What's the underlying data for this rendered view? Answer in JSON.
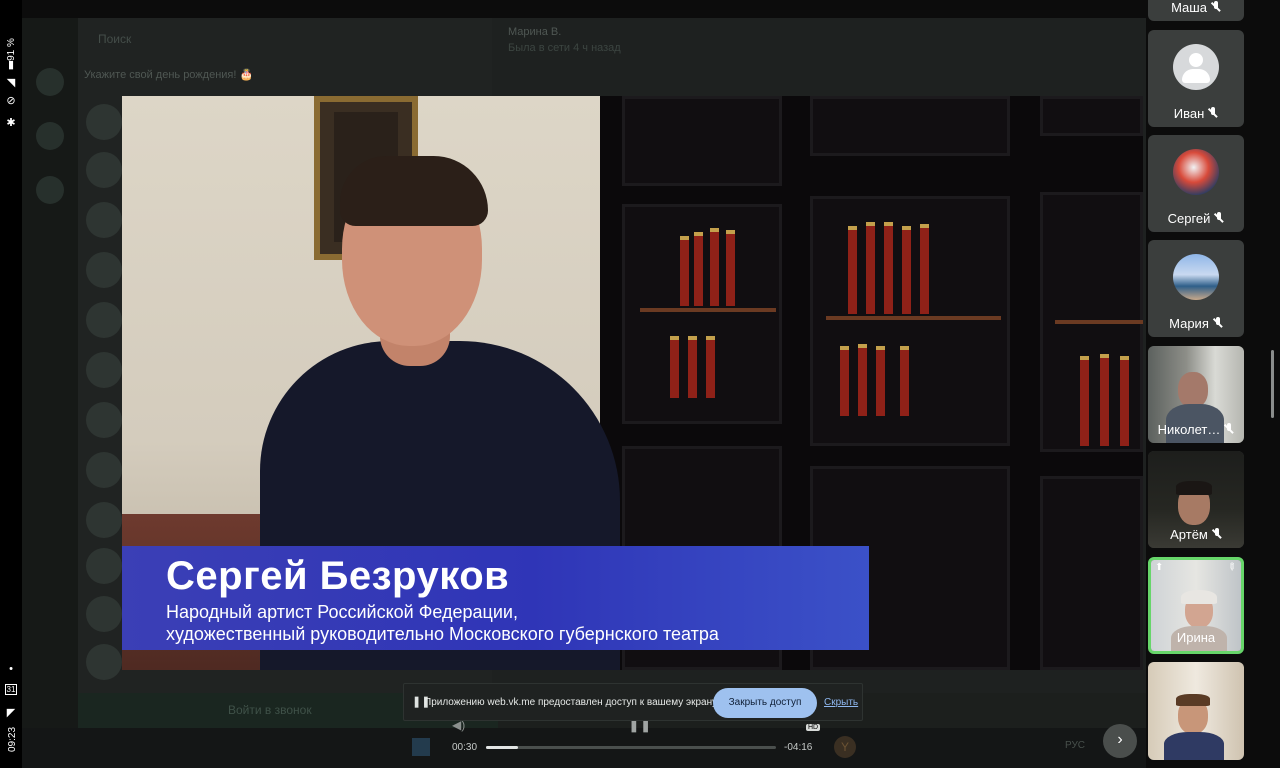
{
  "status_bar": {
    "battery": "91 %",
    "time": "09:23",
    "calendar_badge": "31",
    "icons": [
      "battery-icon",
      "signal-icon",
      "wifi-off-icon",
      "bluetooth-icon",
      "calendar-icon",
      "navigation-icon"
    ]
  },
  "background_app": {
    "search_placeholder": "Поиск",
    "birthday_title": "Укажите свой день рождения! 🎂",
    "chat_name": "Марина В.",
    "chat_status": "Была в сети 4 ч назад",
    "join_call": "Войти в звонок",
    "taskbar_lang": "РУС"
  },
  "video": {
    "caption_name": "Сергей Безруков",
    "caption_role_line1": "Народный артист Российской Федерации,",
    "caption_role_line2": "художественный руководительно Московского губернского театра"
  },
  "player": {
    "elapsed": "00:30",
    "remaining": "-04:16",
    "progress_fraction": 0.11,
    "hd_badge": "HD"
  },
  "share_notice": {
    "text": "Приложению web.vk.me предоставлен доступ к вашему экрану.",
    "close_label": "Закрыть доступ",
    "hide_label": "Скрыть"
  },
  "participants": [
    {
      "name": "Маша",
      "muted": true,
      "avatar": "partial"
    },
    {
      "name": "Иван",
      "muted": true,
      "avatar": "placeholder"
    },
    {
      "name": "Сергей",
      "muted": true,
      "avatar": "photo-ski"
    },
    {
      "name": "Мария",
      "muted": true,
      "avatar": "photo-beach"
    },
    {
      "name": "Николет…",
      "muted": true,
      "avatar": "camera"
    },
    {
      "name": "Артём",
      "muted": true,
      "avatar": "camera"
    },
    {
      "name": "Ирина",
      "muted": false,
      "avatar": "camera",
      "active": true,
      "sharing": true,
      "pinned": true
    },
    {
      "name": "",
      "muted": false,
      "avatar": "camera"
    }
  ],
  "colors": {
    "active_speaker_border": "#67d66a",
    "caption_blue": "#2f35b7",
    "close_button": "#9ec1ef"
  }
}
